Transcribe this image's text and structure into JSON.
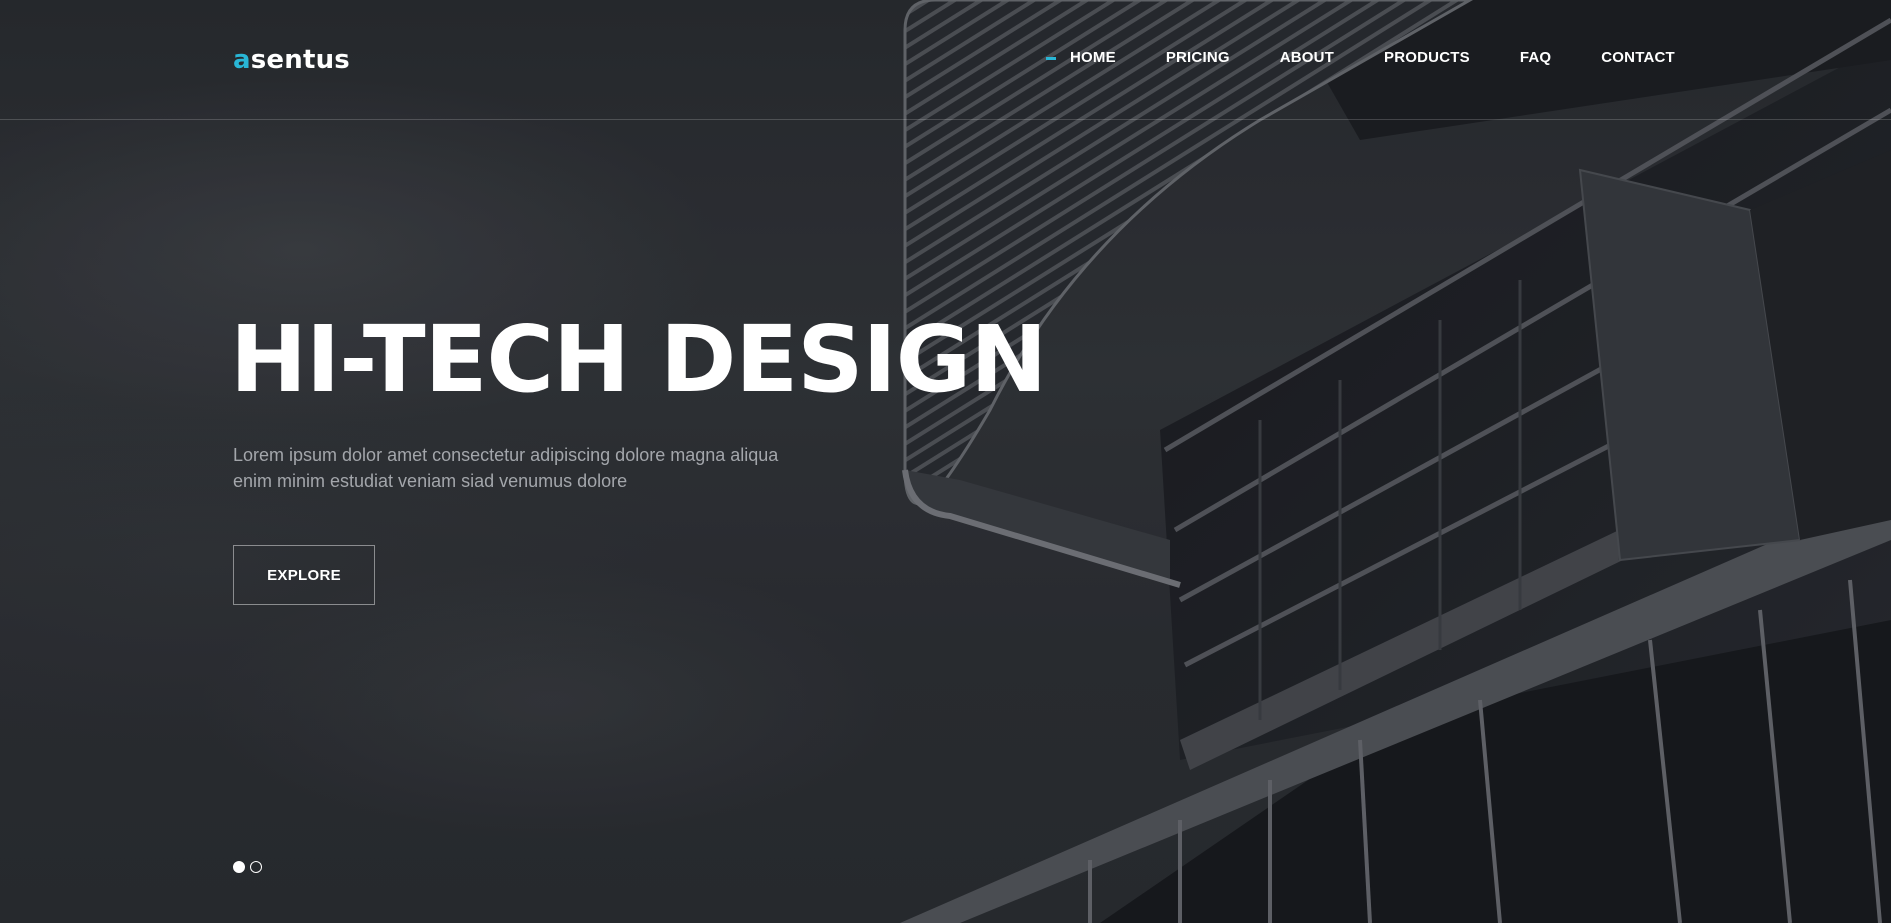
{
  "brand": {
    "logo_accent": "a",
    "logo_rest": "sentus",
    "accent_color": "#29b6d6"
  },
  "nav": {
    "items": [
      {
        "label": "HOME",
        "active": true
      },
      {
        "label": "PRICING",
        "active": false
      },
      {
        "label": "ABOUT",
        "active": false
      },
      {
        "label": "PRODUCTS",
        "active": false
      },
      {
        "label": "FAQ",
        "active": false
      },
      {
        "label": "CONTACT",
        "active": false
      }
    ]
  },
  "hero": {
    "title": "HI-TECH DESIGN",
    "subtitle_line1": "Lorem ipsum dolor amet consectetur adipiscing dolore magna aliqua",
    "subtitle_line2": "enim minim estudiat veniam siad venumus dolore",
    "cta_label": "EXPLORE",
    "background_image": "modern-building-facade-photo"
  },
  "slider": {
    "slide_count": 2,
    "active_slide": 1
  }
}
